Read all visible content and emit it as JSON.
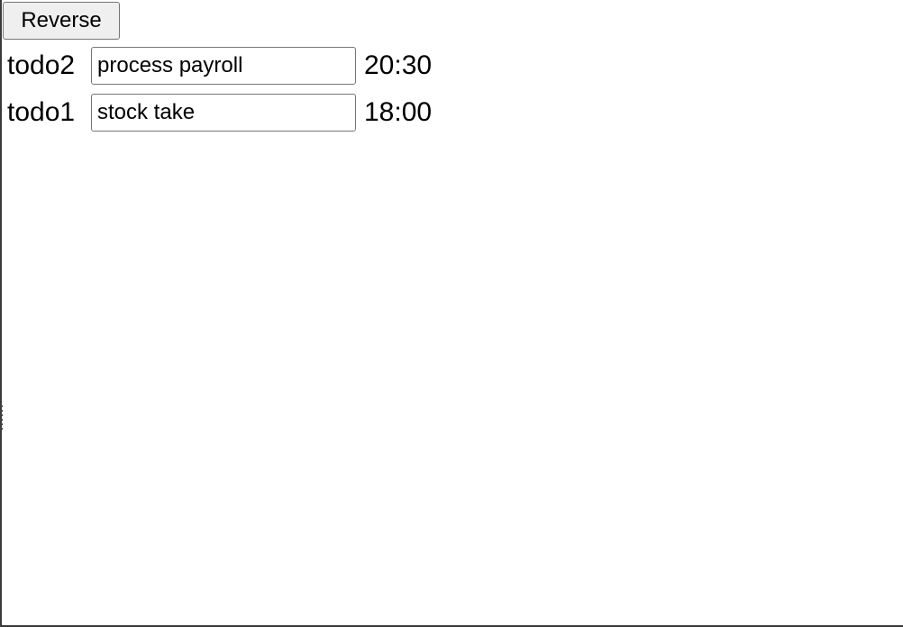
{
  "toolbar": {
    "reverse_label": "Reverse"
  },
  "todos": [
    {
      "id": "todo2",
      "value": "process payroll",
      "time": "20:30"
    },
    {
      "id": "todo1",
      "value": "stock take",
      "time": "18:00"
    }
  ]
}
